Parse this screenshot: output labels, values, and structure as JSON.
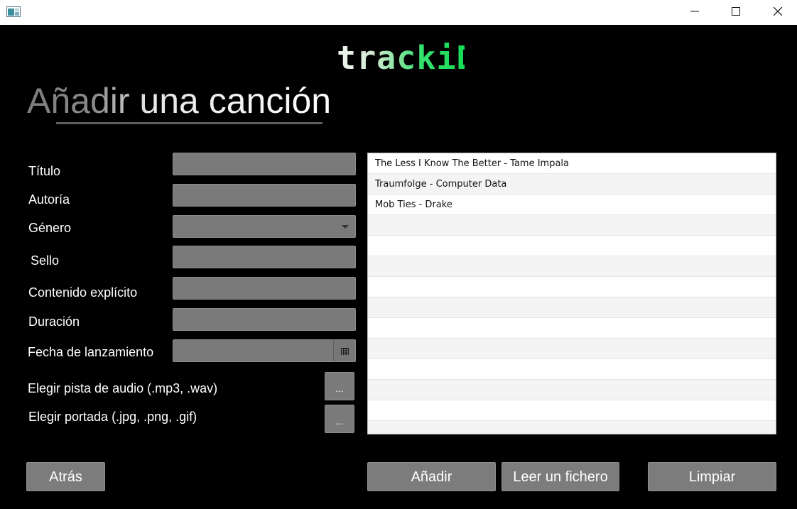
{
  "window": {
    "minimize_icon": "minimize-icon",
    "maximize_icon": "maximize-icon",
    "close_icon": "close-icon"
  },
  "header": {
    "logo": "trackiD",
    "page_title": "Añadir una canción"
  },
  "form": {
    "titulo_label": "Título",
    "autoria_label": "Autoría",
    "genero_label": "Género",
    "sello_label": "Sello",
    "explicito_label": "Contenido explícito",
    "duracion_label": "Duración",
    "fecha_label": "Fecha de lanzamiento",
    "audio_label": "Elegir pista de audio (.mp3, .wav)",
    "portada_label": "Elegir portada (.jpg, .png, .gif)",
    "browse_button": "...",
    "titulo_value": "",
    "autoria_value": "",
    "genero_value": "",
    "sello_value": "",
    "explicito_value": "",
    "duracion_value": "",
    "fecha_value": ""
  },
  "songs": [
    "The Less I Know The Better - Tame Impala",
    "Traumfolge - Computer Data",
    "Mob Ties - Drake",
    "",
    "",
    "",
    "",
    "",
    "",
    "",
    "",
    "",
    ""
  ],
  "buttons": {
    "atras": "Atrás",
    "anadir": "Añadir",
    "leer": "Leer un fichero",
    "limpiar": "Limpiar"
  },
  "colors": {
    "background": "#000000",
    "field": "#7a7a7a",
    "accent_green": "#16dd56"
  }
}
